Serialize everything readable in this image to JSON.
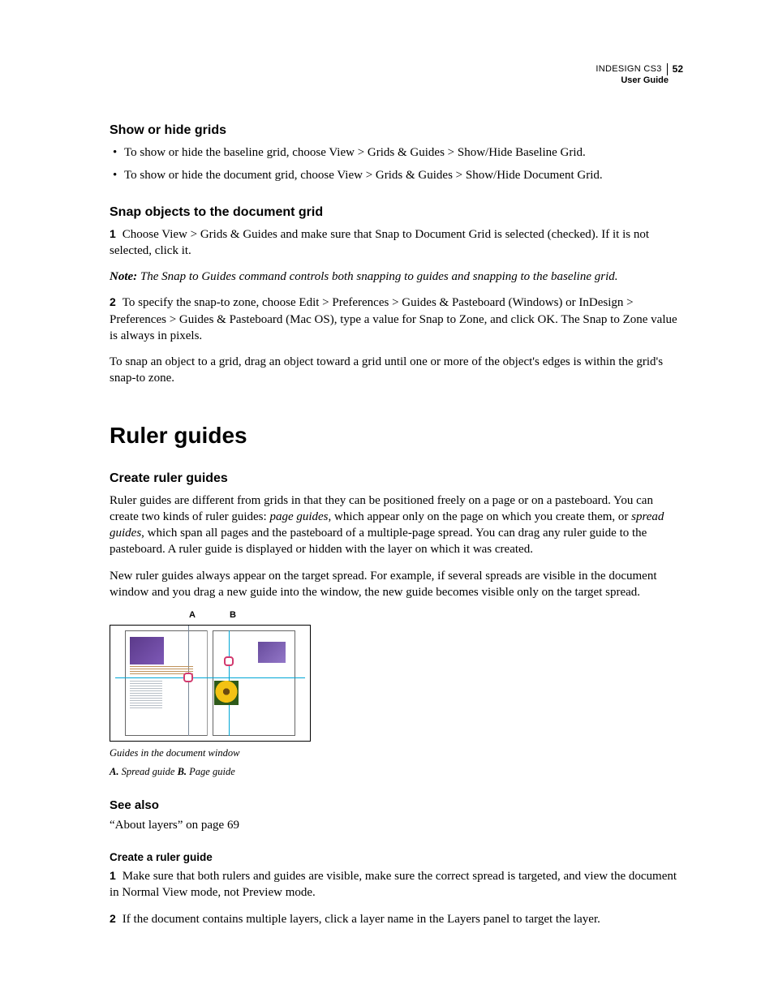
{
  "header": {
    "product": "INDESIGN CS3",
    "page_number": "52",
    "subtitle": "User Guide"
  },
  "section1": {
    "title": "Show or hide grids",
    "bullets": [
      "To show or hide the baseline grid, choose View > Grids & Guides > Show/Hide Baseline Grid.",
      "To show or hide the document grid, choose View > Grids & Guides > Show/Hide Document Grid."
    ]
  },
  "section2": {
    "title": "Snap objects to the document grid",
    "step1_num": "1",
    "step1_text": "Choose View > Grids & Guides and make sure that Snap to Document Grid is selected (checked). If it is not selected, click it.",
    "note_label": "Note:",
    "note_text": "The Snap to Guides command controls both snapping to guides and snapping to the baseline grid.",
    "step2_num": "2",
    "step2_text": "To specify the snap-to zone, choose Edit > Preferences > Guides & Pasteboard (Windows) or InDesign > Preferences > Guides & Pasteboard (Mac OS), type a value for Snap to Zone, and click OK. The Snap to Zone value is always in pixels.",
    "para": "To snap an object to a grid, drag an object toward a grid until one or more of the object's edges is within the grid's snap-to zone."
  },
  "chapter": {
    "title": "Ruler guides"
  },
  "section3": {
    "title": "Create ruler guides",
    "para1_a": "Ruler guides are different from grids in that they can be positioned freely on a page or on a pasteboard. You can create two kinds of ruler guides: ",
    "para1_i1": "page guides",
    "para1_b": ", which appear only on the page on which you create them, or ",
    "para1_i2": "spread guides",
    "para1_c": ", which span all pages and the pasteboard of a multiple-page spread. You can drag any ruler guide to the pasteboard. A ruler guide is displayed or hidden with the layer on which it was created.",
    "para2": "New ruler guides always appear on the target spread. For example, if several spreads are visible in the document window and you drag a new guide into the window, the new guide becomes visible only on the target spread."
  },
  "figure": {
    "label_a": "A",
    "label_b": "B",
    "caption_line1": "Guides in the document window",
    "caption_a_bold": "A.",
    "caption_a_text": " Spread guide  ",
    "caption_b_bold": "B.",
    "caption_b_text": " Page guide"
  },
  "seealso": {
    "title": "See also",
    "link": "“About layers” on page 69"
  },
  "section4": {
    "title": "Create a ruler guide",
    "step1_num": "1",
    "step1_text": "Make sure that both rulers and guides are visible, make sure the correct spread is targeted, and view the document in Normal View mode, not Preview mode.",
    "step2_num": "2",
    "step2_text": "If the document contains multiple layers, click a layer name in the Layers panel to target the layer."
  }
}
